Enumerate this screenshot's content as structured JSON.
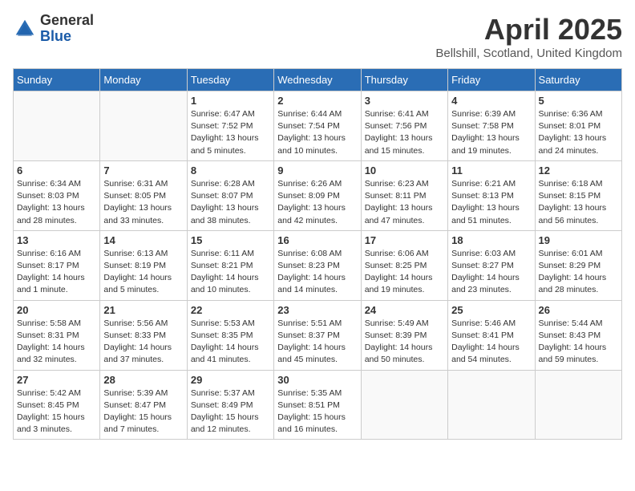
{
  "header": {
    "logo_general": "General",
    "logo_blue": "Blue",
    "month_title": "April 2025",
    "location": "Bellshill, Scotland, United Kingdom"
  },
  "days_of_week": [
    "Sunday",
    "Monday",
    "Tuesday",
    "Wednesday",
    "Thursday",
    "Friday",
    "Saturday"
  ],
  "weeks": [
    [
      {
        "day": "",
        "empty": true
      },
      {
        "day": "",
        "empty": true
      },
      {
        "day": "1",
        "sunrise": "Sunrise: 6:47 AM",
        "sunset": "Sunset: 7:52 PM",
        "daylight": "Daylight: 13 hours and 5 minutes."
      },
      {
        "day": "2",
        "sunrise": "Sunrise: 6:44 AM",
        "sunset": "Sunset: 7:54 PM",
        "daylight": "Daylight: 13 hours and 10 minutes."
      },
      {
        "day": "3",
        "sunrise": "Sunrise: 6:41 AM",
        "sunset": "Sunset: 7:56 PM",
        "daylight": "Daylight: 13 hours and 15 minutes."
      },
      {
        "day": "4",
        "sunrise": "Sunrise: 6:39 AM",
        "sunset": "Sunset: 7:58 PM",
        "daylight": "Daylight: 13 hours and 19 minutes."
      },
      {
        "day": "5",
        "sunrise": "Sunrise: 6:36 AM",
        "sunset": "Sunset: 8:01 PM",
        "daylight": "Daylight: 13 hours and 24 minutes."
      }
    ],
    [
      {
        "day": "6",
        "sunrise": "Sunrise: 6:34 AM",
        "sunset": "Sunset: 8:03 PM",
        "daylight": "Daylight: 13 hours and 28 minutes."
      },
      {
        "day": "7",
        "sunrise": "Sunrise: 6:31 AM",
        "sunset": "Sunset: 8:05 PM",
        "daylight": "Daylight: 13 hours and 33 minutes."
      },
      {
        "day": "8",
        "sunrise": "Sunrise: 6:28 AM",
        "sunset": "Sunset: 8:07 PM",
        "daylight": "Daylight: 13 hours and 38 minutes."
      },
      {
        "day": "9",
        "sunrise": "Sunrise: 6:26 AM",
        "sunset": "Sunset: 8:09 PM",
        "daylight": "Daylight: 13 hours and 42 minutes."
      },
      {
        "day": "10",
        "sunrise": "Sunrise: 6:23 AM",
        "sunset": "Sunset: 8:11 PM",
        "daylight": "Daylight: 13 hours and 47 minutes."
      },
      {
        "day": "11",
        "sunrise": "Sunrise: 6:21 AM",
        "sunset": "Sunset: 8:13 PM",
        "daylight": "Daylight: 13 hours and 51 minutes."
      },
      {
        "day": "12",
        "sunrise": "Sunrise: 6:18 AM",
        "sunset": "Sunset: 8:15 PM",
        "daylight": "Daylight: 13 hours and 56 minutes."
      }
    ],
    [
      {
        "day": "13",
        "sunrise": "Sunrise: 6:16 AM",
        "sunset": "Sunset: 8:17 PM",
        "daylight": "Daylight: 14 hours and 1 minute."
      },
      {
        "day": "14",
        "sunrise": "Sunrise: 6:13 AM",
        "sunset": "Sunset: 8:19 PM",
        "daylight": "Daylight: 14 hours and 5 minutes."
      },
      {
        "day": "15",
        "sunrise": "Sunrise: 6:11 AM",
        "sunset": "Sunset: 8:21 PM",
        "daylight": "Daylight: 14 hours and 10 minutes."
      },
      {
        "day": "16",
        "sunrise": "Sunrise: 6:08 AM",
        "sunset": "Sunset: 8:23 PM",
        "daylight": "Daylight: 14 hours and 14 minutes."
      },
      {
        "day": "17",
        "sunrise": "Sunrise: 6:06 AM",
        "sunset": "Sunset: 8:25 PM",
        "daylight": "Daylight: 14 hours and 19 minutes."
      },
      {
        "day": "18",
        "sunrise": "Sunrise: 6:03 AM",
        "sunset": "Sunset: 8:27 PM",
        "daylight": "Daylight: 14 hours and 23 minutes."
      },
      {
        "day": "19",
        "sunrise": "Sunrise: 6:01 AM",
        "sunset": "Sunset: 8:29 PM",
        "daylight": "Daylight: 14 hours and 28 minutes."
      }
    ],
    [
      {
        "day": "20",
        "sunrise": "Sunrise: 5:58 AM",
        "sunset": "Sunset: 8:31 PM",
        "daylight": "Daylight: 14 hours and 32 minutes."
      },
      {
        "day": "21",
        "sunrise": "Sunrise: 5:56 AM",
        "sunset": "Sunset: 8:33 PM",
        "daylight": "Daylight: 14 hours and 37 minutes."
      },
      {
        "day": "22",
        "sunrise": "Sunrise: 5:53 AM",
        "sunset": "Sunset: 8:35 PM",
        "daylight": "Daylight: 14 hours and 41 minutes."
      },
      {
        "day": "23",
        "sunrise": "Sunrise: 5:51 AM",
        "sunset": "Sunset: 8:37 PM",
        "daylight": "Daylight: 14 hours and 45 minutes."
      },
      {
        "day": "24",
        "sunrise": "Sunrise: 5:49 AM",
        "sunset": "Sunset: 8:39 PM",
        "daylight": "Daylight: 14 hours and 50 minutes."
      },
      {
        "day": "25",
        "sunrise": "Sunrise: 5:46 AM",
        "sunset": "Sunset: 8:41 PM",
        "daylight": "Daylight: 14 hours and 54 minutes."
      },
      {
        "day": "26",
        "sunrise": "Sunrise: 5:44 AM",
        "sunset": "Sunset: 8:43 PM",
        "daylight": "Daylight: 14 hours and 59 minutes."
      }
    ],
    [
      {
        "day": "27",
        "sunrise": "Sunrise: 5:42 AM",
        "sunset": "Sunset: 8:45 PM",
        "daylight": "Daylight: 15 hours and 3 minutes."
      },
      {
        "day": "28",
        "sunrise": "Sunrise: 5:39 AM",
        "sunset": "Sunset: 8:47 PM",
        "daylight": "Daylight: 15 hours and 7 minutes."
      },
      {
        "day": "29",
        "sunrise": "Sunrise: 5:37 AM",
        "sunset": "Sunset: 8:49 PM",
        "daylight": "Daylight: 15 hours and 12 minutes."
      },
      {
        "day": "30",
        "sunrise": "Sunrise: 5:35 AM",
        "sunset": "Sunset: 8:51 PM",
        "daylight": "Daylight: 15 hours and 16 minutes."
      },
      {
        "day": "",
        "empty": true
      },
      {
        "day": "",
        "empty": true
      },
      {
        "day": "",
        "empty": true
      }
    ]
  ]
}
